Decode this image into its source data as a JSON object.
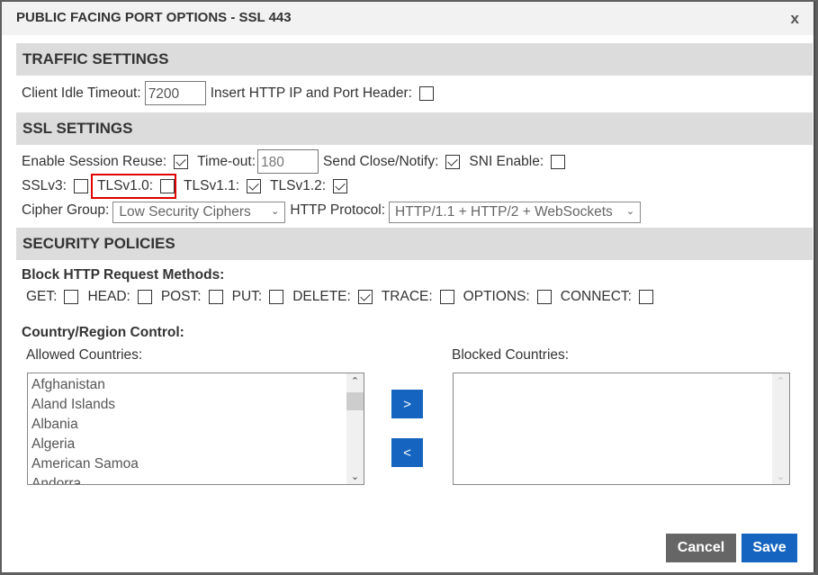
{
  "dialog": {
    "title": "PUBLIC FACING PORT OPTIONS - SSL 443",
    "close_label": "x"
  },
  "traffic": {
    "header": "TRAFFIC SETTINGS",
    "idle_timeout_label": "Client Idle Timeout:",
    "idle_timeout_value": "7200",
    "insert_header_label": "Insert HTTP IP and Port Header:",
    "insert_header_checked": false
  },
  "ssl": {
    "header": "SSL SETTINGS",
    "session_reuse_label": "Enable Session Reuse:",
    "session_reuse_checked": true,
    "timeout_label": "Time-out:",
    "timeout_value": "180",
    "close_notify_label": "Send Close/Notify:",
    "close_notify_checked": true,
    "sni_label": "SNI Enable:",
    "sni_checked": false,
    "protocols": [
      {
        "label": "SSLv3:",
        "checked": false
      },
      {
        "label": "TLSv1.0:",
        "checked": false,
        "highlighted": true
      },
      {
        "label": "TLSv1.1:",
        "checked": true
      },
      {
        "label": "TLSv1.2:",
        "checked": true
      }
    ],
    "cipher_group_label": "Cipher Group:",
    "cipher_group_value": "Low Security Ciphers",
    "http_protocol_label": "HTTP Protocol:",
    "http_protocol_value": "HTTP/1.1 + HTTP/2 + WebSockets"
  },
  "security": {
    "header": "SECURITY POLICIES",
    "block_methods_label": "Block HTTP Request Methods:",
    "methods": [
      {
        "label": "GET:",
        "checked": false
      },
      {
        "label": "HEAD:",
        "checked": false
      },
      {
        "label": "POST:",
        "checked": false
      },
      {
        "label": "PUT:",
        "checked": false
      },
      {
        "label": "DELETE:",
        "checked": true
      },
      {
        "label": "TRACE:",
        "checked": false
      },
      {
        "label": "OPTIONS:",
        "checked": false
      },
      {
        "label": "CONNECT:",
        "checked": false
      }
    ],
    "country_control_label": "Country/Region Control:",
    "allowed_label": "Allowed Countries:",
    "blocked_label": "Blocked Countries:",
    "allowed_countries": [
      "Afghanistan",
      "Aland Islands",
      "Albania",
      "Algeria",
      "American Samoa",
      "Andorra"
    ],
    "blocked_countries": [],
    "move_right_label": ">",
    "move_left_label": "<"
  },
  "footer": {
    "cancel_label": "Cancel",
    "save_label": "Save"
  },
  "colors": {
    "primary": "#1565c0",
    "secondary": "#666666",
    "highlight": "#e00000"
  }
}
